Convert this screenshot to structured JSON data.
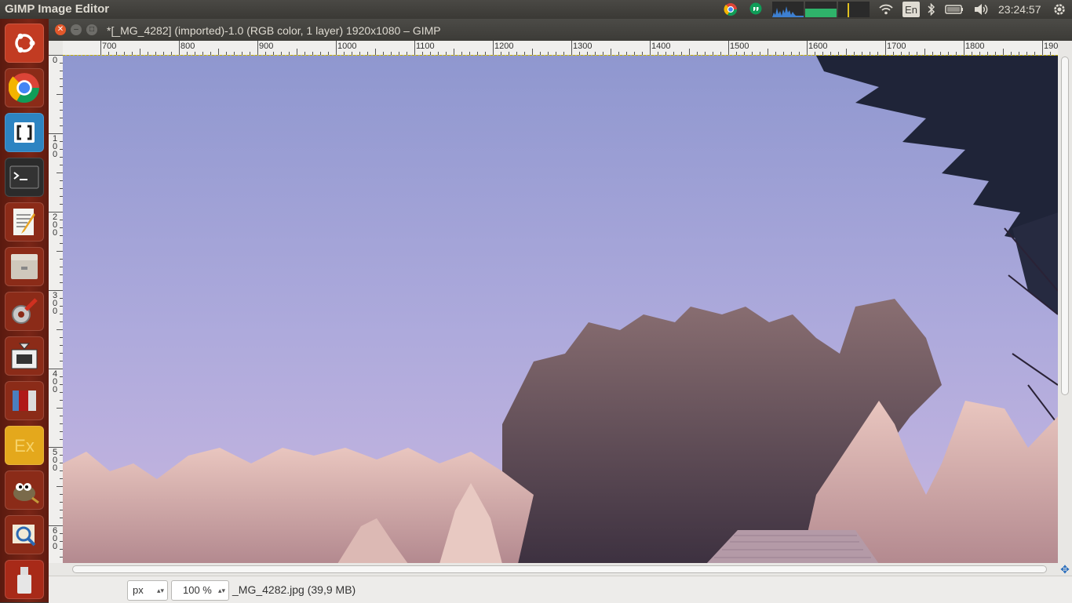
{
  "topbar": {
    "app_title": "GIMP Image Editor",
    "keyboard_layout": "En",
    "clock": "23:24:57"
  },
  "window": {
    "title": "*[_MG_4282] (imported)-1.0 (RGB color, 1 layer) 1920x1080 – GIMP"
  },
  "ruler": {
    "h_labels": [
      "700",
      "800",
      "900",
      "1000",
      "1100",
      "1200",
      "1300",
      "1400",
      "1500",
      "1600",
      "1700",
      "1800",
      "190"
    ],
    "v_labels": [
      "0",
      "100",
      "200",
      "300",
      "400",
      "500",
      "600"
    ]
  },
  "status": {
    "unit": "px",
    "zoom": "100 %",
    "file_info": "_MG_4282.jpg (39,9 MB)"
  },
  "launcher": {
    "icons": [
      "ubuntu-dash-icon",
      "chrome-icon",
      "brackets-icon",
      "terminal-icon",
      "text-editor-icon",
      "files-icon",
      "system-settings-icon",
      "software-updater-icon",
      "app-icon",
      "exaile-icon",
      "gimp-icon",
      "image-viewer-icon",
      "usb-drive-icon"
    ]
  },
  "colors": {
    "launcher_bg": "#7a2516",
    "panel_bg": "#3c3b37",
    "sky_top": "#8f97cf",
    "sky_bottom": "#c2b4e0"
  }
}
